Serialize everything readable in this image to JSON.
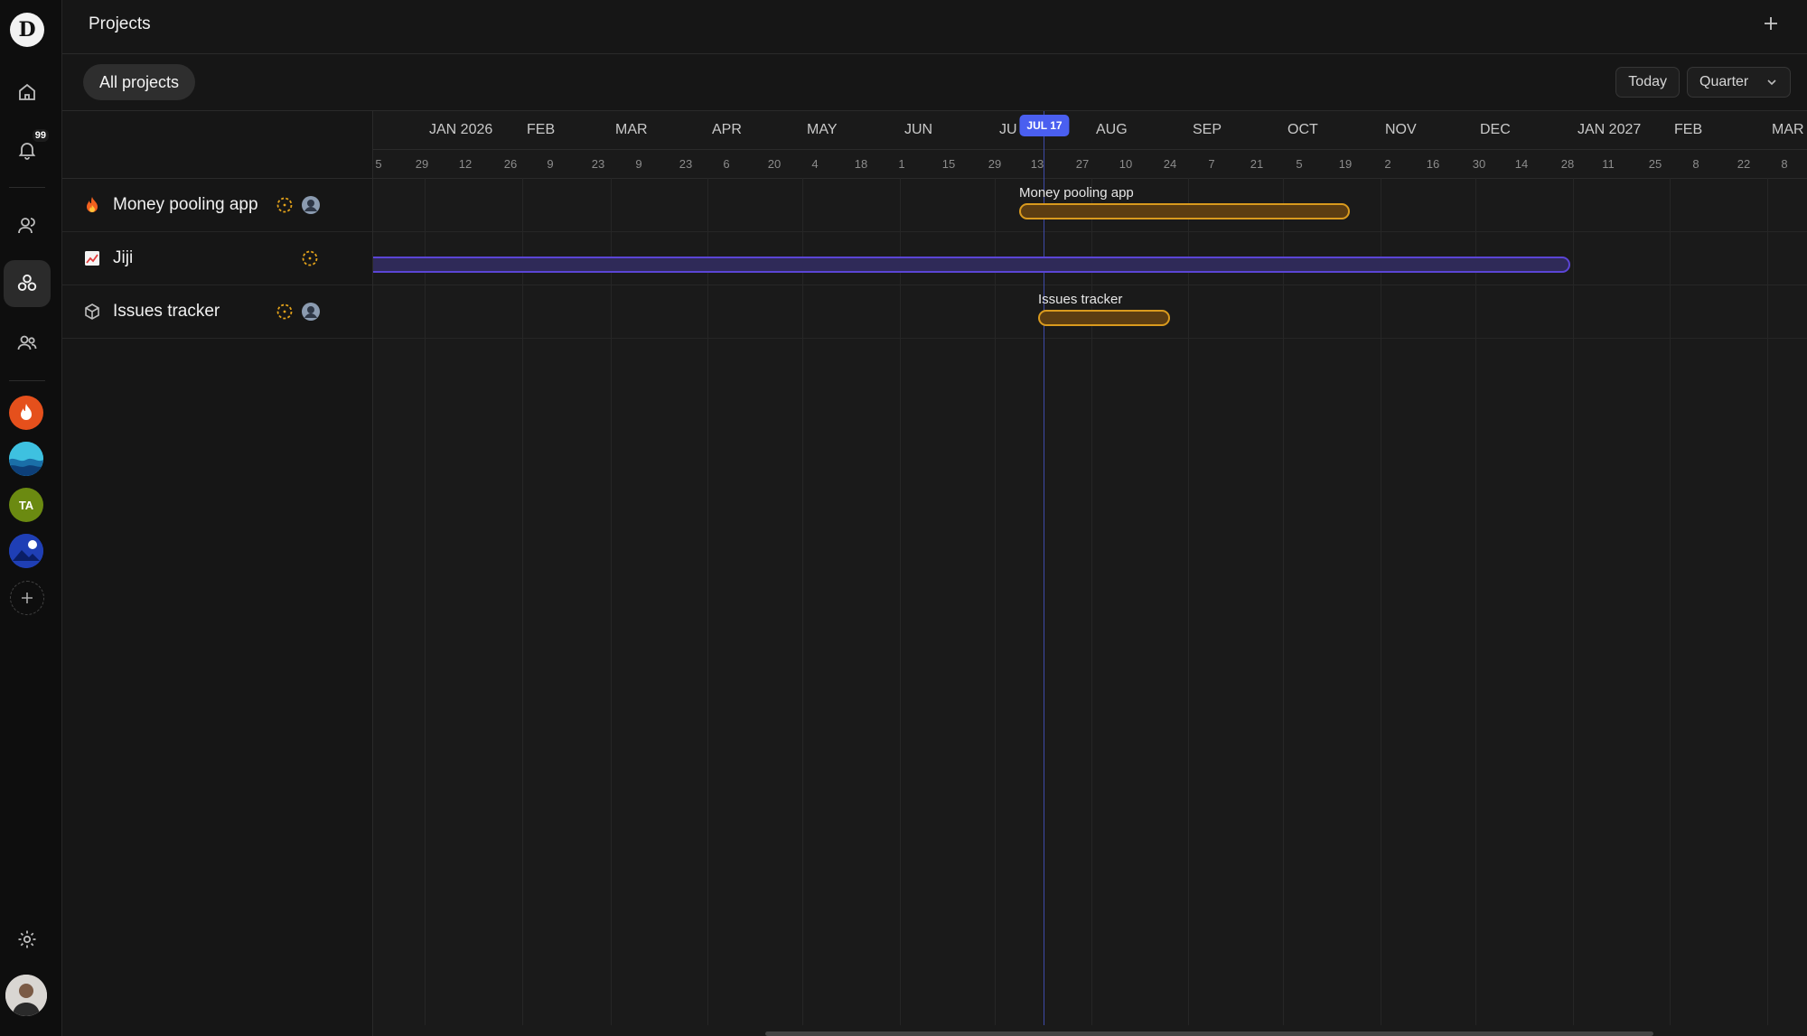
{
  "app": {
    "logo_letter": "D",
    "nav": {
      "notifications_count": "99",
      "workspaces": [
        {
          "name": "fire-workspace",
          "color": "#e5501c"
        },
        {
          "name": "wave-workspace",
          "color": "#29a3c7"
        },
        {
          "name": "ta-workspace",
          "initials": "TA",
          "color": "#6b8a11"
        },
        {
          "name": "space-workspace",
          "color": "#2042b8"
        }
      ]
    }
  },
  "header": {
    "title": "Projects"
  },
  "filters": {
    "active_view": "All projects",
    "today_label": "Today",
    "zoom_label": "Quarter"
  },
  "timeline": {
    "today_label": "JUL 17",
    "months": [
      "JAN 2026",
      "FEB",
      "MAR",
      "APR",
      "MAY",
      "JUN",
      "JU",
      "AUG",
      "SEP",
      "OCT",
      "NOV",
      "DEC",
      "JAN 2027",
      "FEB",
      "MAR"
    ],
    "weeks": [
      "5",
      "29",
      "12",
      "26",
      "9",
      "23",
      "9",
      "23",
      "6",
      "20",
      "4",
      "18",
      "1",
      "15",
      "29",
      "13",
      "27",
      "10",
      "24",
      "7",
      "21",
      "5",
      "19",
      "2",
      "16",
      "30",
      "14",
      "28",
      "11",
      "25",
      "8",
      "22",
      "8"
    ]
  },
  "projects": [
    {
      "name": "Money pooling app",
      "icon": "fire-icon",
      "bar_label": "Money pooling app",
      "bar_color": "#d99a1e"
    },
    {
      "name": "Jiji",
      "icon": "chart-icon",
      "bar_label": "",
      "bar_color": "#5b45d6"
    },
    {
      "name": "Issues tracker",
      "icon": "cube-icon",
      "bar_label": "Issues tracker",
      "bar_color": "#d99a1e"
    }
  ]
}
